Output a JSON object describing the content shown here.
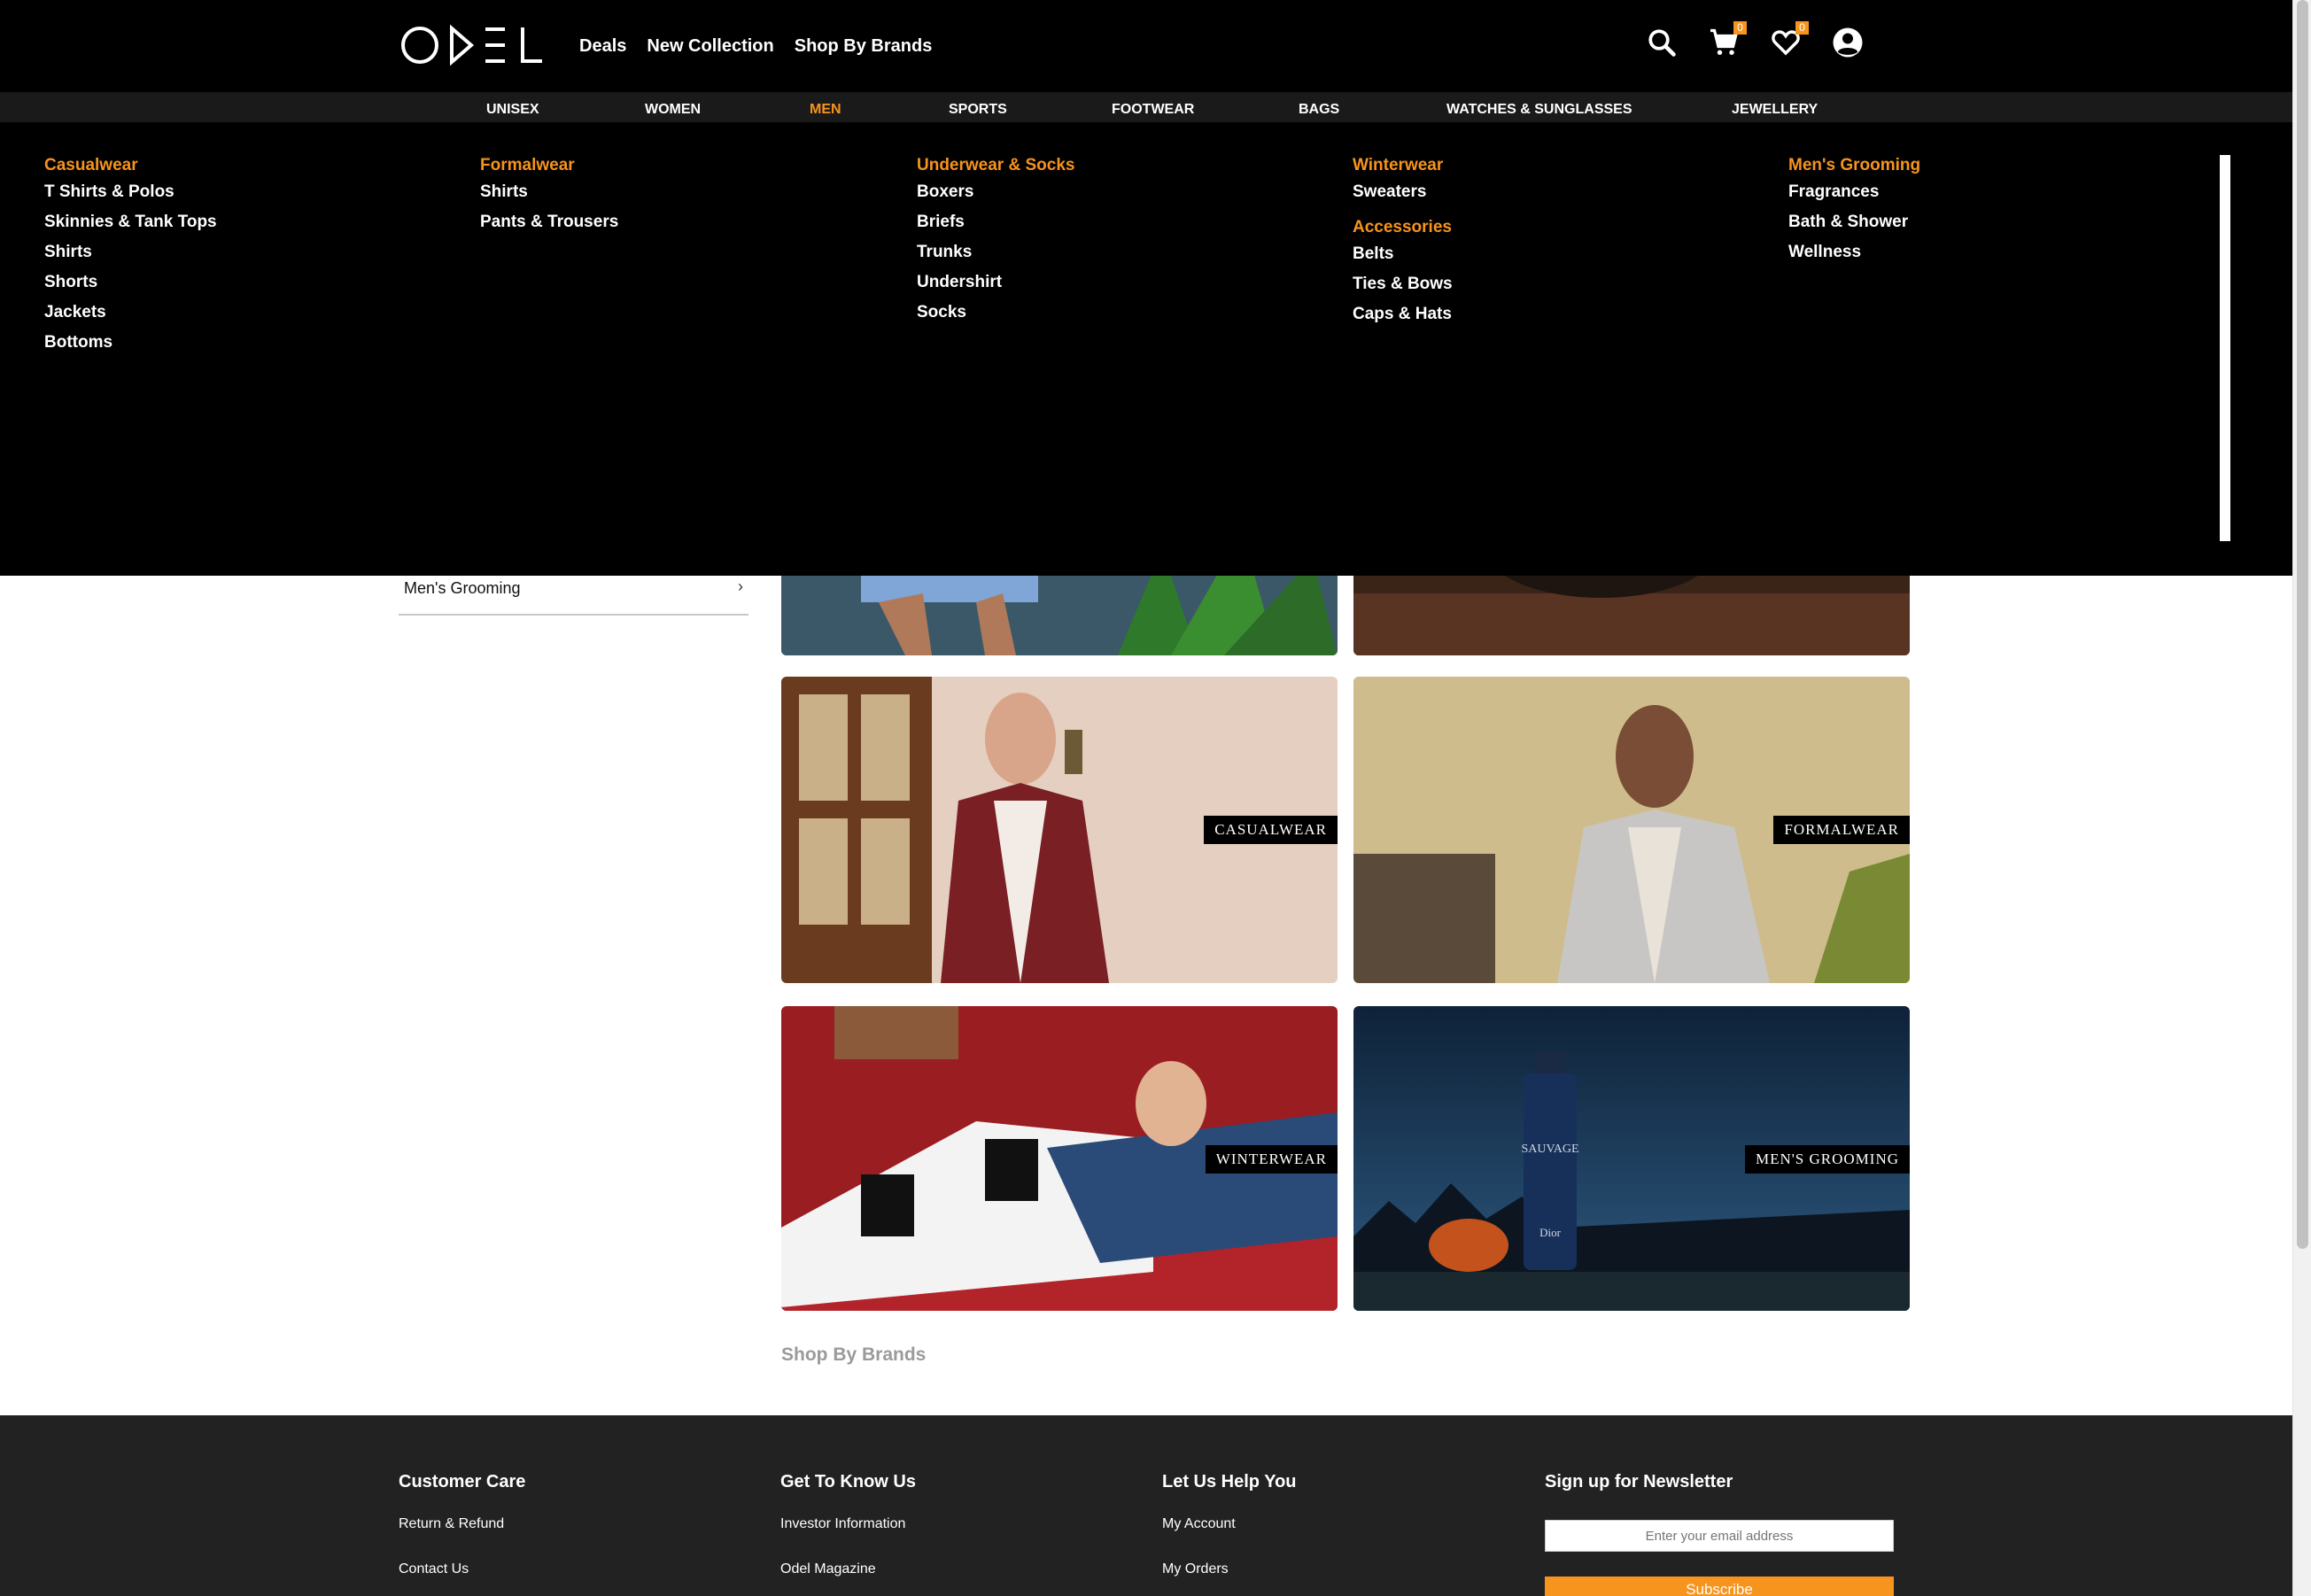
{
  "header": {
    "logo_text": "ODEL",
    "nav": [
      "Deals",
      "New Collection",
      "Shop By Brands"
    ],
    "cart_count": "0",
    "wishlist_count": "0"
  },
  "categories": [
    "UNISEX",
    "WOMEN",
    "MEN",
    "SPORTS",
    "FOOTWEAR",
    "BAGS",
    "WATCHES & SUNGLASSES",
    "JEWELLERY"
  ],
  "active_category": "MEN",
  "mega_menu": {
    "casualwear": {
      "title": "Casualwear",
      "items": [
        "T Shirts & Polos",
        "Skinnies & Tank Tops",
        "Shirts",
        "Shorts",
        "Jackets",
        "Bottoms"
      ]
    },
    "formalwear": {
      "title": "Formalwear",
      "items": [
        "Shirts",
        "Pants & Trousers"
      ]
    },
    "underwear": {
      "title": "Underwear & Socks",
      "items": [
        "Boxers",
        "Briefs",
        "Trunks",
        "Undershirt",
        "Socks"
      ]
    },
    "winterwear": {
      "title": "Winterwear",
      "items": [
        "Sweaters"
      ]
    },
    "accessories": {
      "title": "Accessories",
      "items": [
        "Belts",
        "Ties & Bows",
        "Caps & Hats"
      ]
    },
    "grooming": {
      "title": "Men's Grooming",
      "items": [
        "Fragrances",
        "Bath & Shower",
        "Wellness"
      ]
    }
  },
  "sidebar": {
    "item_label": "Men's Grooming"
  },
  "tiles": {
    "casualwear": "CASUALWEAR",
    "formalwear": "FORMALWEAR",
    "winterwear": "WINTERWEAR",
    "grooming": "MEN'S GROOMING",
    "bottle_brand": "SAUVAGE",
    "bottle_maker": "Dior"
  },
  "shop_by_brands": "Shop By Brands",
  "footer": {
    "customer_care": {
      "title": "Customer Care",
      "links": [
        "Return & Refund",
        "Contact Us"
      ]
    },
    "get_to_know": {
      "title": "Get To Know Us",
      "links": [
        "Investor Information",
        "Odel Magazine"
      ]
    },
    "help": {
      "title": "Let Us Help You",
      "links": [
        "My Account",
        "My Orders"
      ]
    },
    "newsletter": {
      "title": "Sign up for Newsletter",
      "placeholder": "Enter your email address",
      "button": "Subscribe"
    }
  },
  "colors": {
    "accent": "#f7941d",
    "header_bg": "#000000",
    "catbar_bg": "#1a1a1a",
    "footer_bg": "#222222"
  }
}
